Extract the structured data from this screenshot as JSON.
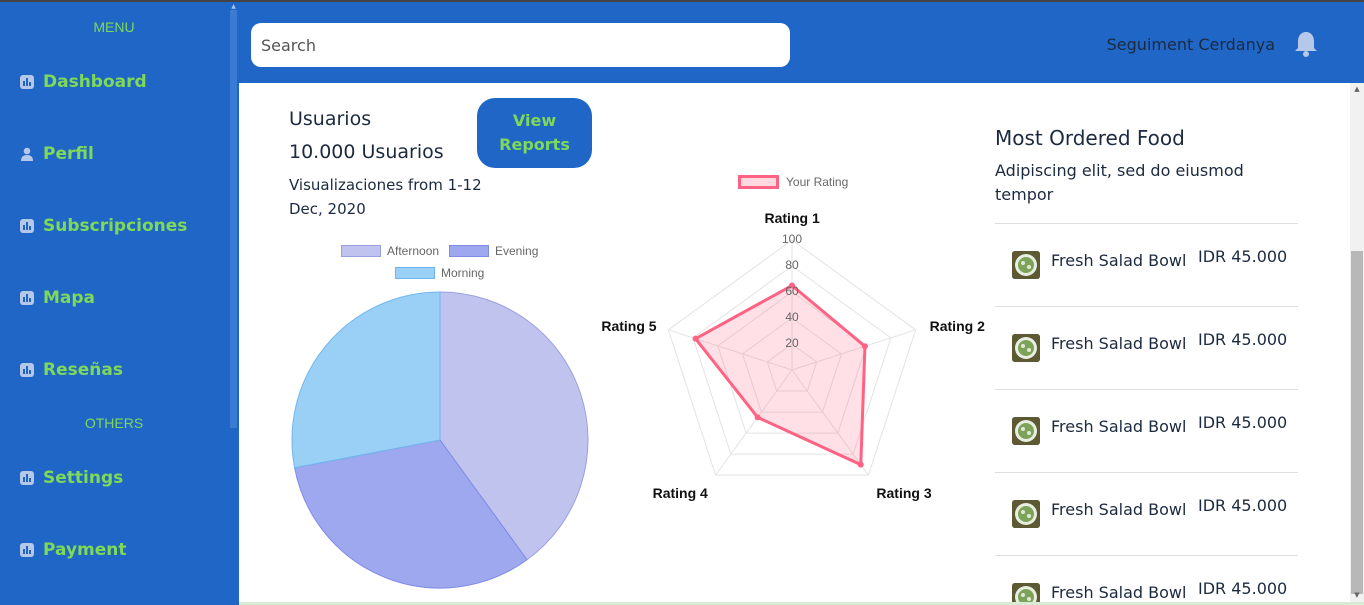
{
  "colors": {
    "primary": "#1f66c7",
    "accent_green": "#7ed957",
    "text_dark": "#1c2a3f",
    "radar_line": "#ff6384"
  },
  "sidebar": {
    "menu_heading": "MENU",
    "others_heading": "OTHERS",
    "items": [
      {
        "label": "Dashboard",
        "icon": "chart-bar-icon"
      },
      {
        "label": "Perfil",
        "icon": "user-icon"
      },
      {
        "label": "Subscripciones",
        "icon": "chart-bar-icon"
      },
      {
        "label": "Mapa",
        "icon": "chart-bar-icon"
      },
      {
        "label": "Reseñas",
        "icon": "chart-bar-icon"
      },
      {
        "label": "Settings",
        "icon": "chart-bar-icon"
      },
      {
        "label": "Payment",
        "icon": "chart-bar-icon"
      }
    ]
  },
  "header": {
    "search": {
      "placeholder": "Search",
      "value": ""
    },
    "user_name": "Seguiment Cerdanya",
    "bell_icon": "bell-icon"
  },
  "stats": {
    "title": "Usuarios",
    "count": "10.000 Usuarios",
    "subtitle": "Visualizaciones from 1-12 Dec, 2020",
    "view_reports_label": "View Reports"
  },
  "chart_data": [
    {
      "type": "pie",
      "legend_position": "top",
      "categories": [
        "Afternoon",
        "Evening",
        "Morning"
      ],
      "values": [
        40,
        32,
        28
      ],
      "colors": [
        "#bfc3ee",
        "#9ea8ee",
        "#9ad0f5"
      ]
    },
    {
      "type": "radar",
      "legend_position": "top",
      "categories": [
        "Rating 1",
        "Rating 2",
        "Rating 3",
        "Rating 4",
        "Rating 5"
      ],
      "series": [
        {
          "name": "Your Rating",
          "values": [
            65,
            59,
            90,
            45,
            78
          ]
        }
      ],
      "r_ticks": [
        "20",
        "40",
        "60",
        "80",
        "100"
      ],
      "rlim": [
        0,
        100
      ]
    }
  ],
  "most_ordered": {
    "title": "Most Ordered Food",
    "subtitle": "Adipiscing elit, sed do eiusmod tempor",
    "items": [
      {
        "name": "Fresh Salad Bowl",
        "price": "IDR 45.000"
      },
      {
        "name": "Fresh Salad Bowl",
        "price": "IDR 45.000"
      },
      {
        "name": "Fresh Salad Bowl",
        "price": "IDR 45.000"
      },
      {
        "name": "Fresh Salad Bowl",
        "price": "IDR 45.000"
      },
      {
        "name": "Fresh Salad Bowl",
        "price": "IDR 45.000"
      }
    ]
  }
}
